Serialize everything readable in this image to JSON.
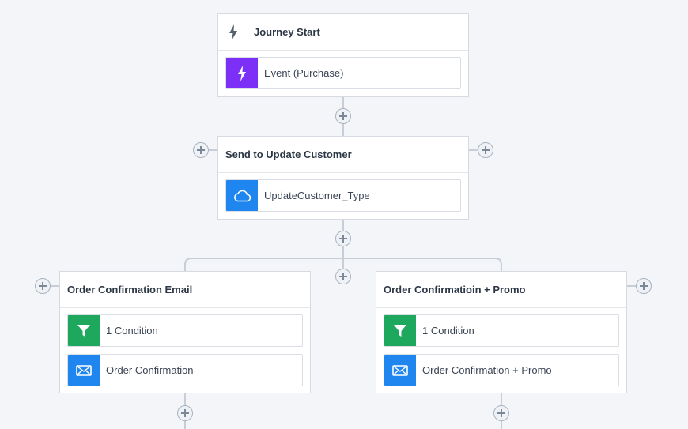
{
  "colors": {
    "event": "#7b2ff7",
    "api": "#1f86ef",
    "condition": "#1ea85d",
    "email": "#1f86ef"
  },
  "journey_start": {
    "title": "Journey Start",
    "title_icon": "lightning-icon",
    "items": [
      {
        "label": "Event (Purchase)",
        "icon": "lightning-icon"
      }
    ]
  },
  "update_customer": {
    "title": "Send to Update Customer",
    "items": [
      {
        "label": "UpdateCustomer_Type",
        "icon": "cloud-icon"
      }
    ]
  },
  "branch_left": {
    "title": "Order Confirmation Email",
    "items": [
      {
        "label": "1 Condition",
        "icon": "filter-icon"
      },
      {
        "label": "Order Confirmation",
        "icon": "envelope-icon"
      }
    ]
  },
  "branch_right": {
    "title": "Order Confirmatioin + Promo",
    "items": [
      {
        "label": "1 Condition",
        "icon": "filter-icon"
      },
      {
        "label": "Order Confirmation + Promo",
        "icon": "envelope-icon"
      }
    ]
  }
}
